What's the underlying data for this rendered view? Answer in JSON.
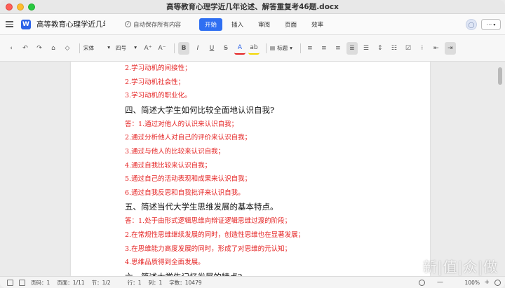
{
  "window": {
    "title": "高等教育心理学近几年论述、解答重复考46题.docx"
  },
  "appbar": {
    "doc_logo": "W",
    "doc_name": "高等教育心理学近几年...",
    "autosave": "自动保存所有内容",
    "tabs": [
      "开始",
      "插入",
      "审阅",
      "页面",
      "效率"
    ],
    "active_tab": "开始",
    "more": "···"
  },
  "toolbar": {
    "font": "宋体",
    "size": "四号",
    "grow": "A⁺",
    "shrink": "A⁻",
    "bold": "B",
    "italic": "I",
    "underline": "U",
    "strike": "S",
    "font_color": "A",
    "highlight": "ab",
    "style": "标题"
  },
  "document": {
    "lines": [
      {
        "type": "red",
        "text": "2.学习动机的间接性；"
      },
      {
        "type": "red",
        "text": "2.学习动机社会性；"
      },
      {
        "type": "red",
        "text": "3.学习动机的职业化。"
      },
      {
        "type": "head",
        "text": "四、简述大学生如何比较全面地认识自我?"
      },
      {
        "type": "red",
        "text": "答：1.通过对他人的认识来认识自我；"
      },
      {
        "type": "red",
        "text": "2.通过分析他人对自己的评价来认识自我；"
      },
      {
        "type": "red",
        "text": "3.通过与他人的比较来认识自我；"
      },
      {
        "type": "red",
        "text": "4.通过自我比较来认识自我；"
      },
      {
        "type": "red",
        "text": "5.通过自己的活动表现和成果来认识自我；"
      },
      {
        "type": "red",
        "text": "6.通过自我反思和自我批评来认识自我。"
      },
      {
        "type": "head",
        "text": "五、简述当代大学生思维发展的基本特点。"
      },
      {
        "type": "red",
        "text": "答：1.处于由形式逻辑思维向辩证逻辑思维过渡的阶段；"
      },
      {
        "type": "red",
        "text": "2.在常规性思维继续发展的同时，创造性思维也在显著发展；"
      },
      {
        "type": "red",
        "text": "3.在思维能力高度发展的同时，形成了对思维的元认知；"
      },
      {
        "type": "red",
        "text": "4.思维品质得到全面发展。"
      },
      {
        "type": "head",
        "text": "六、简述大学生记忆发展的特点?"
      }
    ]
  },
  "watermark": "新|值|众|做",
  "statusbar": {
    "pages": "页码：1",
    "page_of": "页面：1/11",
    "section": "节：1/2",
    "row": "行：1",
    "col": "列：1",
    "words": "字数：10479",
    "zoom": "100%",
    "zoom_minus": "—",
    "zoom_plus": "+"
  }
}
